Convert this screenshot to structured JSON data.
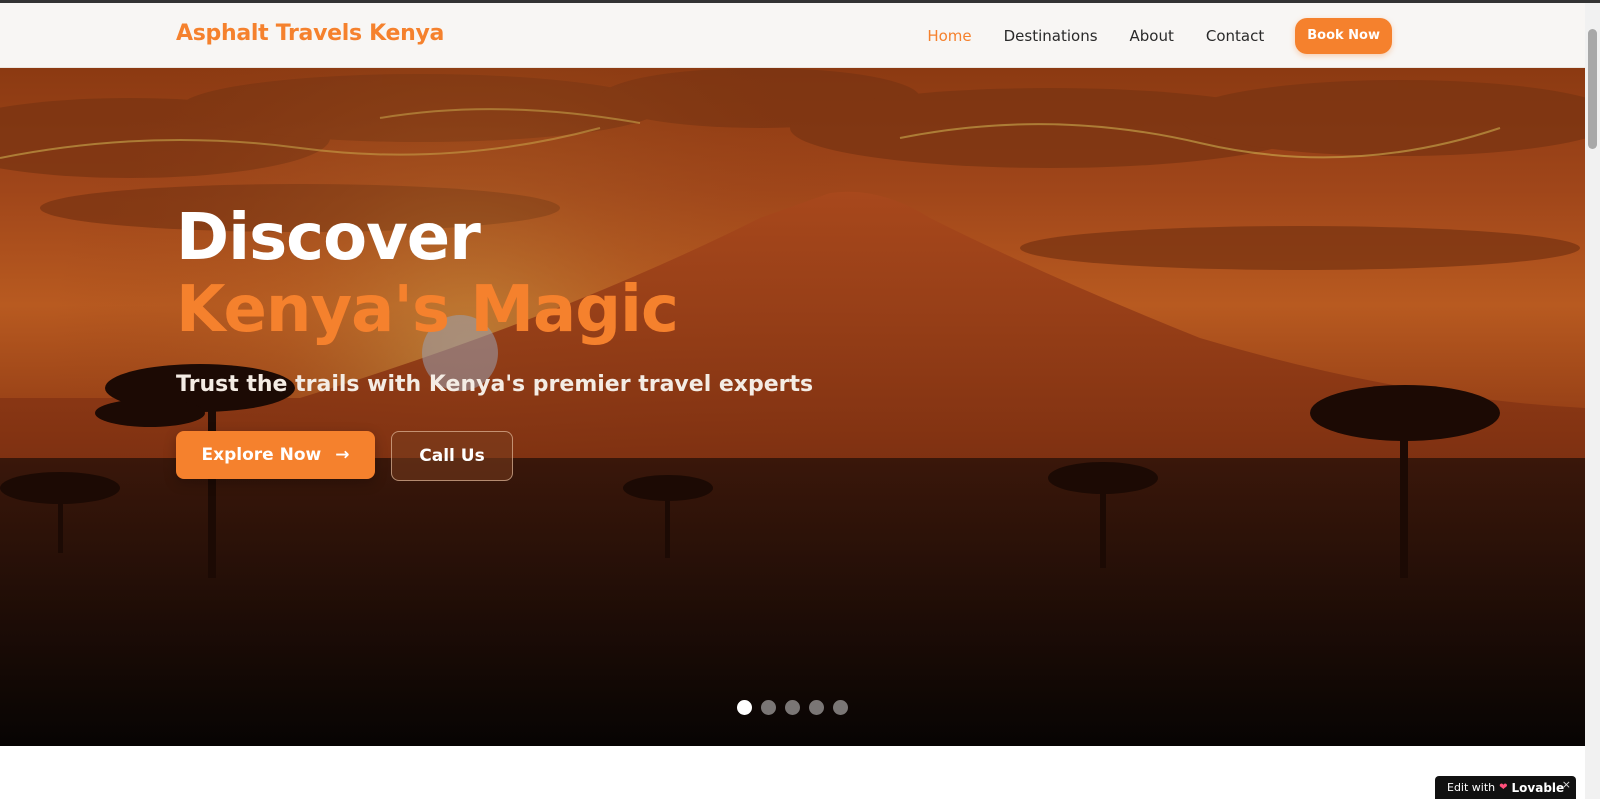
{
  "nav": {
    "brand": "Asphalt Travels Kenya",
    "links": [
      "Home",
      "Destinations",
      "About",
      "Contact"
    ],
    "active": "Home",
    "cta": "Book Now"
  },
  "hero": {
    "title_line1": "Discover",
    "title_line2": "Kenya's Magic",
    "subtitle": "Trust the trails with Kenya's premier travel experts",
    "primary_button": "Explore Now",
    "primary_icon": "arrow-right-icon",
    "secondary_button": "Call Us",
    "slides_total": 5,
    "active_slide": 1
  },
  "badge": {
    "prefix": "Edit with",
    "brand": "Lovable",
    "close": "×"
  },
  "colors": {
    "accent": "#f5812d",
    "nav_bg": "#f8f6f4",
    "text_dark": "#2a2a2a"
  }
}
